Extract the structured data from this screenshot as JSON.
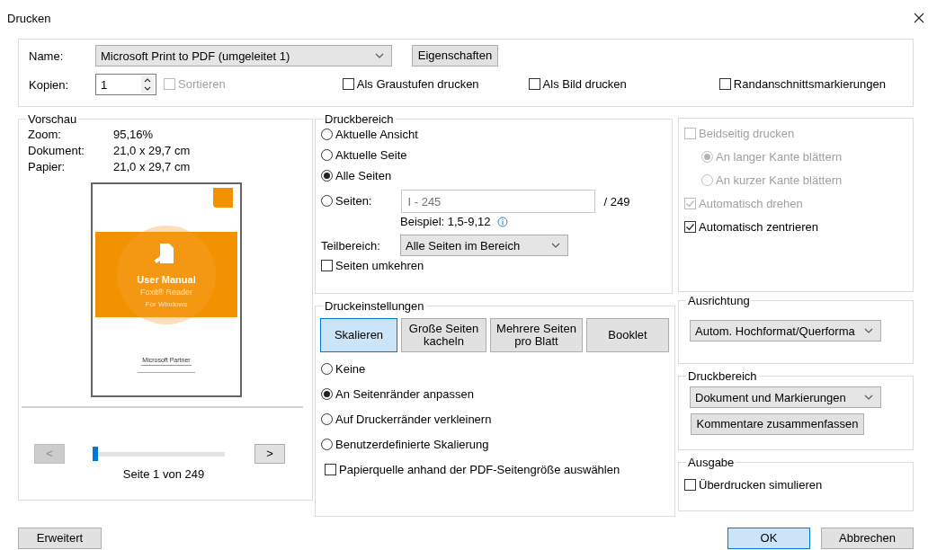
{
  "window": {
    "title": "Drucken"
  },
  "printer": {
    "name_label": "Name:",
    "name_value": "Microsoft Print to PDF (umgeleitet 1)",
    "properties_button": "Eigenschaften",
    "copies_label": "Kopien:",
    "copies_value": "1",
    "options": [
      {
        "label": "Sortieren",
        "checked": false,
        "disabled": true
      },
      {
        "label": "Als Graustufen drucken",
        "checked": false,
        "disabled": false
      },
      {
        "label": "Als Bild drucken",
        "checked": false,
        "disabled": false
      },
      {
        "label": "Randanschnittsmarkierungen",
        "checked": false,
        "disabled": false
      }
    ]
  },
  "preview": {
    "title": "Vorschau",
    "info": [
      {
        "label": "Zoom:",
        "value": "95,16%"
      },
      {
        "label": "Dokument:",
        "value": "21,0 x 29,7 cm"
      },
      {
        "label": "Papier:",
        "value": "21,0 x 29,7 cm"
      }
    ],
    "page": {
      "title": "User Manual",
      "product": "Foxit® Reader",
      "platform": "For Windows",
      "partner": "Microsoft Partner"
    },
    "prev_button": "<",
    "prev_disabled": true,
    "next_button": ">",
    "slider": {
      "level": 0
    },
    "page_label": "Seite 1 von 249"
  },
  "print_range": {
    "title": "Druckbereich",
    "options": [
      {
        "label": "Aktuelle Ansicht",
        "selected": false
      },
      {
        "label": "Aktuelle Seite",
        "selected": false
      },
      {
        "label": "Alle Seiten",
        "selected": true
      },
      {
        "label": "Seiten:",
        "selected": false
      }
    ],
    "pages_field": {
      "placeholder": "I - 245"
    },
    "total": "/ 249",
    "example": "Beispiel: 1,5-9,12",
    "subset_label": "Teilbereich:",
    "subset_value": "Alle Seiten im Bereich",
    "reverse": {
      "label": "Seiten umkehren",
      "checked": false
    }
  },
  "print_settings": {
    "title": "Druckeinstellungen",
    "modes": [
      {
        "label": "Skalieren",
        "selected": true
      },
      {
        "label": "Große Seiten kacheln",
        "selected": false
      },
      {
        "label": "Mehrere Seiten pro Blatt",
        "selected": false
      },
      {
        "label": "Booklet",
        "selected": false
      }
    ],
    "scaling": [
      {
        "label": "Keine",
        "selected": false
      },
      {
        "label": "An Seitenränder anpassen",
        "selected": true
      },
      {
        "label": "Auf Druckerränder verkleinern",
        "selected": false
      },
      {
        "label": "Benutzerdefinierte Skalierung",
        "selected": false
      }
    ],
    "paper_source": {
      "label": "Papierquelle anhand der PDF-Seitengröße auswählen",
      "checked": false
    }
  },
  "duplex": {
    "options": [
      {
        "kind": "checkbox",
        "label": "Beidseitig drucken",
        "checked": false,
        "disabled": true
      },
      {
        "kind": "radio",
        "label": "An langer Kante blättern",
        "selected": true,
        "disabled": true
      },
      {
        "kind": "radio",
        "label": "An kurzer Kante blättern",
        "selected": false,
        "disabled": true
      },
      {
        "kind": "checkbox",
        "label": "Automatisch drehen",
        "checked": true,
        "disabled": true
      },
      {
        "kind": "checkbox",
        "label": "Automatisch zentrieren",
        "checked": true,
        "disabled": false
      }
    ]
  },
  "orientation": {
    "title": "Ausrichtung",
    "value": "Autom. Hochformat/Querforma"
  },
  "comments": {
    "title": "Druckbereich",
    "value": "Dokument und Markierungen",
    "summarize_button": "Kommentare zusammenfassen"
  },
  "output": {
    "title": "Ausgabe",
    "overprint": {
      "label": "Überdrucken simulieren",
      "checked": false
    }
  },
  "buttons": {
    "advanced": "Erweitert",
    "ok": "OK",
    "cancel": "Abbrechen"
  }
}
